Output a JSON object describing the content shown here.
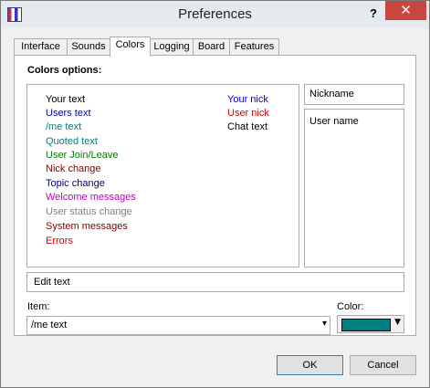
{
  "window": {
    "title": "Preferences",
    "help_label": "?",
    "close_label": "✕"
  },
  "tabs": [
    {
      "label": "Interface"
    },
    {
      "label": "Sounds"
    },
    {
      "label": "Colors",
      "active": true
    },
    {
      "label": "Logging"
    },
    {
      "label": "Board"
    },
    {
      "label": "Features"
    }
  ],
  "colors": {
    "group_label": "Colors options:",
    "items_left": [
      {
        "label": "Your text",
        "color": "#000000"
      },
      {
        "label": "Users text",
        "color": "#0000c8"
      },
      {
        "label": "/me text",
        "color": "#008080"
      },
      {
        "label": "Quoted text",
        "color": "#008080"
      },
      {
        "label": "User Join/Leave",
        "color": "#008000"
      },
      {
        "label": "Nick change",
        "color": "#800000"
      },
      {
        "label": "Topic change",
        "color": "#000080"
      },
      {
        "label": "Welcome messages",
        "color": "#c000c0"
      },
      {
        "label": "User status change",
        "color": "#808080"
      },
      {
        "label": "System messages",
        "color": "#800000"
      },
      {
        "label": "Errors",
        "color": "#cc0000"
      }
    ],
    "items_right": [
      {
        "label": "Your nick",
        "color": "#0000c8"
      },
      {
        "label": "User nick",
        "color": "#cc0000"
      },
      {
        "label": "Chat text",
        "color": "#000000"
      }
    ],
    "nickname_preview": "Nickname",
    "username_preview": "User name",
    "edit_preview": "Edit text",
    "item_label": "Item:",
    "item_value": "/me text",
    "color_label": "Color:",
    "selected_color": "#008080"
  },
  "buttons": {
    "ok": "OK",
    "cancel": "Cancel"
  }
}
